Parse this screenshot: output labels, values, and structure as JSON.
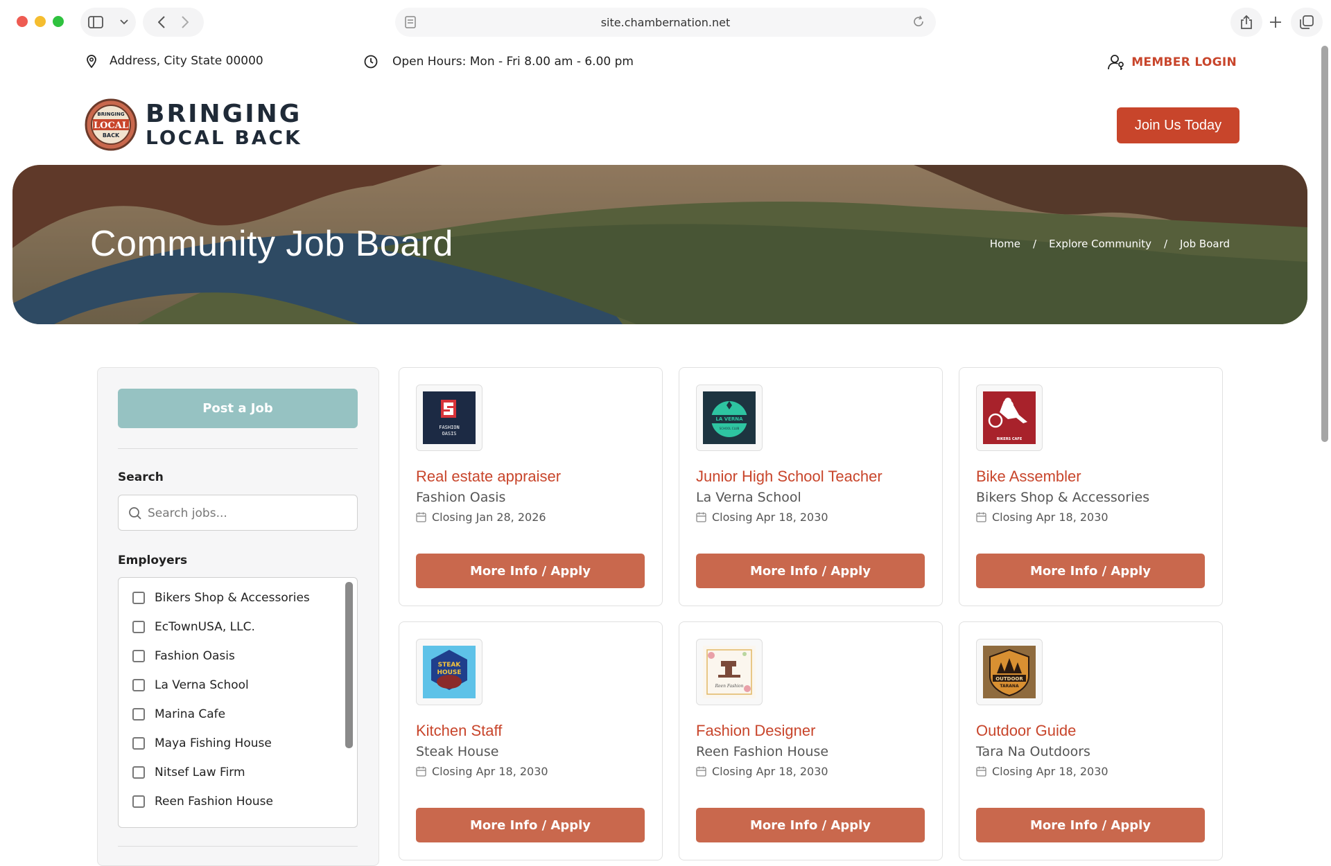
{
  "browser": {
    "url": "site.chambernation.net"
  },
  "topbar": {
    "address": "Address, City State 00000",
    "hours": "Open Hours: Mon - Fri 8.00 am - 6.00 pm",
    "login": "MEMBER LOGIN"
  },
  "header": {
    "logo_line1": "BRINGING",
    "logo_line2": "LOCAL BACK",
    "badge_top": "BRINGING",
    "badge_mid": "LOCAL",
    "badge_bottom": "BACK",
    "join_label": "Join Us Today"
  },
  "hero": {
    "title": "Community Job Board",
    "breadcrumb": [
      "Home",
      "/",
      "Explore Community",
      "/",
      "Job Board"
    ]
  },
  "sidebar": {
    "post_label": "Post a Job",
    "search_label": "Search",
    "search_placeholder": "Search jobs...",
    "employers_label": "Employers",
    "employers": [
      "Bikers Shop & Accessories",
      "EcTownUSA, LLC.",
      "Fashion Oasis",
      "La Verna School",
      "Marina Cafe",
      "Maya Fishing House",
      "Nitsef Law Firm",
      "Reen Fashion House"
    ]
  },
  "jobs": [
    {
      "title": "Real estate appraiser",
      "company": "Fashion Oasis",
      "closing": "Closing Jan 28, 2026",
      "button": "More Info / Apply",
      "logo_icon": "fashion-oasis-logo",
      "logo_text1": "FASHION",
      "logo_text2": "OASIS"
    },
    {
      "title": "Junior High School Teacher",
      "company": "La Verna School",
      "closing": "Closing Apr 18, 2030",
      "button": "More Info / Apply",
      "logo_icon": "la-verna-logo",
      "logo_text1": "LA VERNA",
      "logo_text2": "SCHOOL CLUB"
    },
    {
      "title": "Bike Assembler",
      "company": "Bikers Shop & Accessories",
      "closing": "Closing Apr 18, 2030",
      "button": "More Info / Apply",
      "logo_icon": "bikers-cafe-logo",
      "logo_text1": "BIKERS CAFE",
      "logo_text2": ""
    },
    {
      "title": "Kitchen Staff",
      "company": "Steak House",
      "closing": "Closing Apr 18, 2030",
      "button": "More Info / Apply",
      "logo_icon": "steak-house-logo",
      "logo_text1": "STEAK",
      "logo_text2": "HOUSE"
    },
    {
      "title": "Fashion Designer",
      "company": "Reen Fashion House",
      "closing": "Closing Apr 18, 2030",
      "button": "More Info / Apply",
      "logo_icon": "reen-fashion-logo",
      "logo_text1": "Reen Fashion",
      "logo_text2": ""
    },
    {
      "title": "Outdoor Guide",
      "company": "Tara Na Outdoors",
      "closing": "Closing Apr 18, 2030",
      "button": "More Info / Apply",
      "logo_icon": "outdoor-tarana-logo",
      "logo_text1": "OUTDOOR",
      "logo_text2": "TARANA"
    }
  ],
  "colors": {
    "accent": "#c8452b",
    "apply_button": "#c9684d",
    "post_button": "#96c2c2"
  }
}
